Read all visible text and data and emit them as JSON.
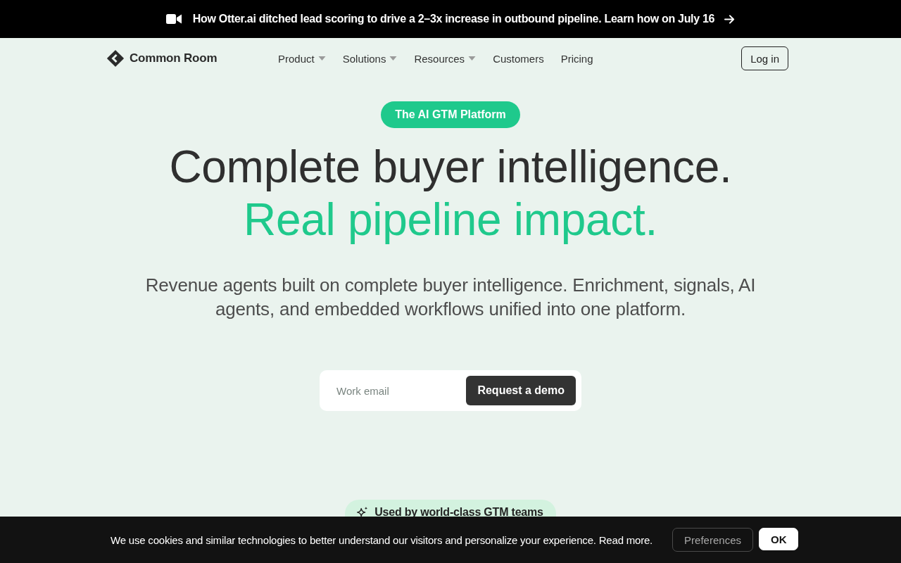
{
  "announcement": {
    "text": "How Otter.ai ditched lead scoring to drive a 2–3x increase in outbound pipeline. Learn how on July 16"
  },
  "nav": {
    "brand": "Common Room",
    "items": [
      {
        "label": "Product",
        "dropdown": true
      },
      {
        "label": "Solutions",
        "dropdown": true
      },
      {
        "label": "Resources",
        "dropdown": true
      },
      {
        "label": "Customers",
        "dropdown": false
      },
      {
        "label": "Pricing",
        "dropdown": false
      }
    ],
    "login": "Log in"
  },
  "hero": {
    "badge": "The AI GTM Platform",
    "headline": "Complete buyer intelligence.",
    "headline_accent": "Real pipeline impact.",
    "subtitle": "Revenue agents built on complete buyer intelligence. Enrichment, signals, AI agents, and embedded workflows unified into one platform.",
    "email_field": {
      "placeholder": "Work email"
    },
    "cta": "Request a demo"
  },
  "social_proof": {
    "label": "Used by world-class GTM teams"
  },
  "cookie_banner": {
    "text": "We use cookies and similar technologies to better understand our visitors and personalize your experience. Read more.",
    "buttons": [
      {
        "label": "Preferences",
        "kind": "secondary"
      },
      {
        "label": "OK",
        "kind": "primary"
      }
    ]
  }
}
